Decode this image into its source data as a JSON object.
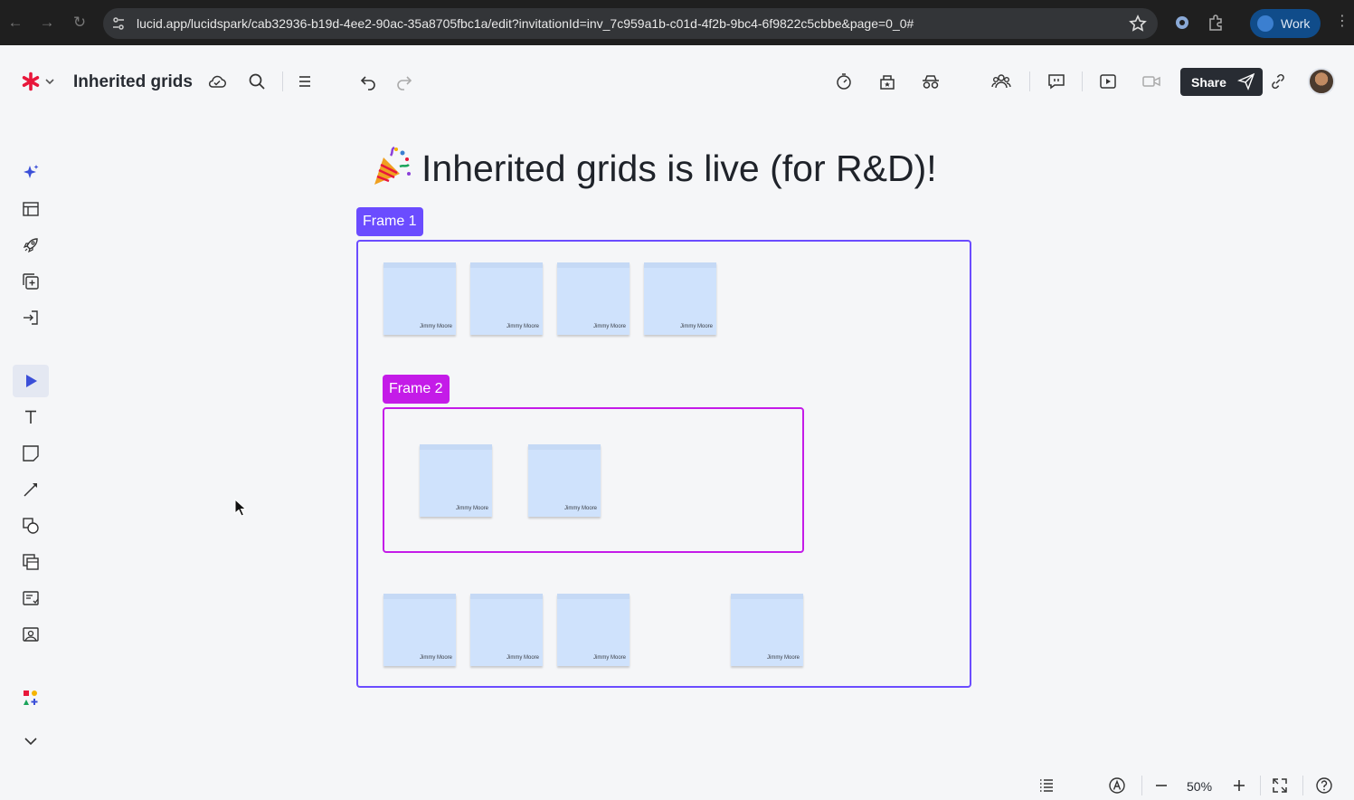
{
  "browser": {
    "url": "lucid.app/lucidspark/cab32936-b19d-4ee2-90ac-35a8705fbc1a/edit?invitationId=inv_7c959a1b-c01d-4f2b-9bc4-6f9822c5cbbe&page=0_0#",
    "profile_label": "Work"
  },
  "app": {
    "doc_title": "Inherited grids",
    "share_label": "Share",
    "brand_color": "#e8173b"
  },
  "canvas": {
    "board_title": "Inherited grids is live (for R&D)!",
    "frame1": {
      "label": "Frame 1",
      "color": "#6b4cff"
    },
    "frame2": {
      "label": "Frame 2",
      "color": "#c41be8"
    },
    "sticky_author": "Jimmy Moore",
    "sticky_color": "#cfe2fc"
  },
  "bottom_bar": {
    "zoom": "50%"
  },
  "icons": {
    "left_toolbar": [
      "sparkle-icon",
      "table-icon",
      "rocket-icon",
      "add-frame-icon",
      "import-icon",
      "pointer-icon",
      "text-icon",
      "sticky-note-icon",
      "line-icon",
      "shapes-icon",
      "containers-icon",
      "templates-icon",
      "image-icon",
      "apps-icon",
      "chevron-down-icon"
    ]
  }
}
